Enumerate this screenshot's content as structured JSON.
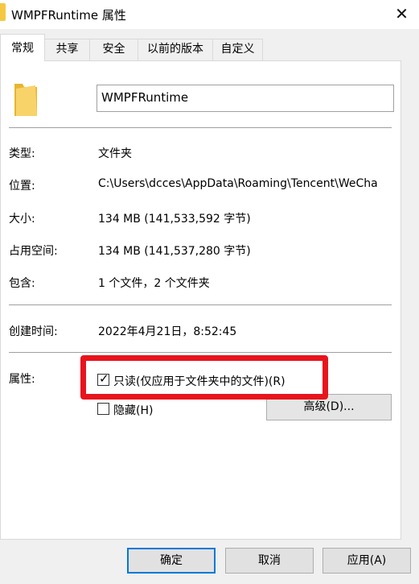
{
  "window": {
    "title": "WMPFRuntime 属性",
    "close_glyph": "✕"
  },
  "tabs": [
    {
      "label": "常规",
      "active": true
    },
    {
      "label": "共享",
      "active": false
    },
    {
      "label": "安全",
      "active": false
    },
    {
      "label": "以前的版本",
      "active": false
    },
    {
      "label": "自定义",
      "active": false
    }
  ],
  "general": {
    "icon": "folder-icon",
    "name_value": "WMPFRuntime",
    "type_label": "类型:",
    "type_value": "文件夹",
    "location_label": "位置:",
    "location_value": "C:\\Users\\dcces\\AppData\\Roaming\\Tencent\\WeCha",
    "size_label": "大小:",
    "size_value": "134 MB (141,533,592 字节)",
    "disk_size_label": "占用空间:",
    "disk_size_value": "134 MB (141,537,280 字节)",
    "contains_label": "包含:",
    "contains_value": "1 个文件，2 个文件夹",
    "created_label": "创建时间:",
    "created_value": "2022年4月21日，8:52:45",
    "attributes_label": "属性:",
    "readonly_label": "只读(仅应用于文件夹中的文件)(R)",
    "readonly_checked": true,
    "hidden_label": "隐藏(H)",
    "hidden_checked": false,
    "advanced_button": "高级(D)..."
  },
  "footer": {
    "ok": "确定",
    "cancel": "取消",
    "apply": "应用(A)"
  },
  "colors": {
    "highlight": "#e8141d",
    "folder": "#f5c842",
    "default_button_border": "#0078d7"
  }
}
